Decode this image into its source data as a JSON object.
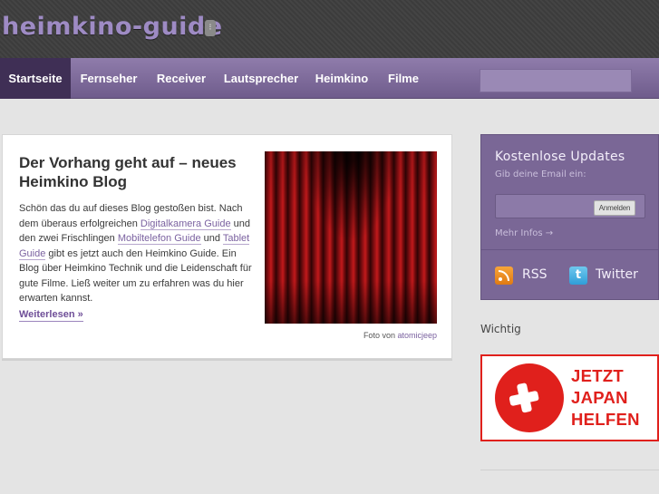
{
  "site": {
    "logo_text": "heimkino-guide",
    "logo_badge": "⁝"
  },
  "nav": {
    "items": [
      {
        "label": "Startseite",
        "active": true
      },
      {
        "label": "Fernseher",
        "active": false
      },
      {
        "label": "Receiver",
        "active": false
      },
      {
        "label": "Lautsprecher",
        "active": false
      },
      {
        "label": "Heimkino",
        "active": false
      },
      {
        "label": "Filme",
        "active": false
      }
    ],
    "search_placeholder": ""
  },
  "post": {
    "title": "Der Vorhang geht auf – neues Heimkino Blog",
    "body": {
      "t1": "Schön das du auf dieses Blog gestoßen bist. Nach dem überaus erfolgreichen ",
      "l1": "Digitalkamera Guide",
      "t2": " und den zwei Frischlingen ",
      "l2": "Mobiltelefon Guide",
      "t3": " und ",
      "l3": "Tablet Guide",
      "t4": " gibt es jetzt auch den Heimkino Guide. Ein Blog über Heimkino Technik und die Leidenschaft für gute Filme. Ließ weiter um zu erfahren was du hier erwarten kannst."
    },
    "read_more": "Weiterlesen »",
    "photo_credit_prefix": "Foto von ",
    "photo_credit_source": "atomicjeep"
  },
  "sidebar": {
    "updates": {
      "title": "Kostenlose Updates",
      "hint": "Gib deine Email ein:",
      "email_placeholder": "",
      "button": "Anmelden",
      "more": "Mehr Infos →",
      "rss": "RSS",
      "twitter": "Twitter"
    },
    "section_label": "Wichtig",
    "banner": {
      "line1": "JETZT",
      "line2": "JAPAN",
      "line3": "HELFEN"
    }
  },
  "colors": {
    "brand_purple": "#7a6796",
    "nav_active": "#3f2f55",
    "link": "#7b62a0",
    "banner_red": "#e0201c"
  }
}
